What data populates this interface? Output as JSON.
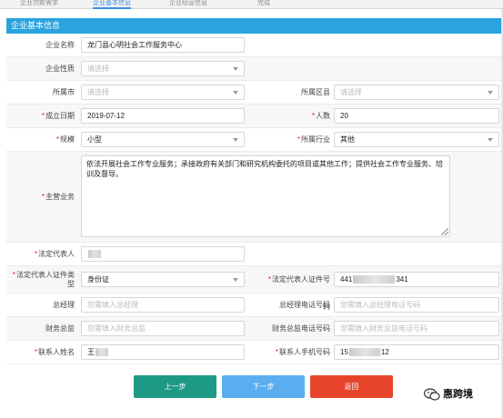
{
  "steps": [
    "企业贷款需求",
    "企业基本信息",
    "企业经营信息",
    "完成"
  ],
  "section_title": "企业基本信息",
  "fields": {
    "company_name": {
      "label": "企业名称",
      "value": "龙门县心明社会工作服务中心"
    },
    "company_type": {
      "label": "企业性质",
      "placeholder": "请选择"
    },
    "city": {
      "label": "所属市",
      "placeholder": "请选择"
    },
    "district": {
      "label": "所属区县",
      "placeholder": "请选择"
    },
    "founded": {
      "label": "成立日期",
      "value": "2019-07-12"
    },
    "headcount": {
      "label": "人数",
      "value": "20"
    },
    "scale": {
      "label": "规模",
      "value": "小型"
    },
    "industry": {
      "label": "所属行业",
      "value": "其他"
    },
    "main_business": {
      "label": "主营业务",
      "value": "依法开展社会工作专业服务；承接政府有关部门和研究机构委托的项目或其他工作；提供社会工作专业服务、培训及督导。"
    },
    "legal_rep": {
      "label": "法定代表人"
    },
    "legal_id_type": {
      "label": "法定代表人证件类型",
      "value": "身份证"
    },
    "legal_id_no": {
      "label": "法定代表人证件号码",
      "prefix": "441",
      "suffix": "341"
    },
    "gm": {
      "label": "总经理",
      "placeholder": "您需填入总经理"
    },
    "gm_phone": {
      "label": "总经理电话号码",
      "placeholder": "您需填入总经理电话号码"
    },
    "cfo": {
      "label": "财务总监",
      "placeholder": "您需填入财务总监"
    },
    "cfo_phone": {
      "label": "财务总监电话号码",
      "placeholder": "您需填入财务总监电话号码"
    },
    "contact": {
      "label": "联系人姓名",
      "prefix": "王"
    },
    "contact_phone": {
      "label": "联系人手机号码",
      "prefix": "15",
      "suffix": "12"
    }
  },
  "buttons": {
    "prev": "上一步",
    "next": "下一步",
    "back": "返回"
  },
  "watermark": "惠跨境",
  "colors": {
    "header": "#2aa3de",
    "prev": "#1d9a86",
    "next": "#5aaef0",
    "back": "#e6452b",
    "required": "#e02020"
  }
}
